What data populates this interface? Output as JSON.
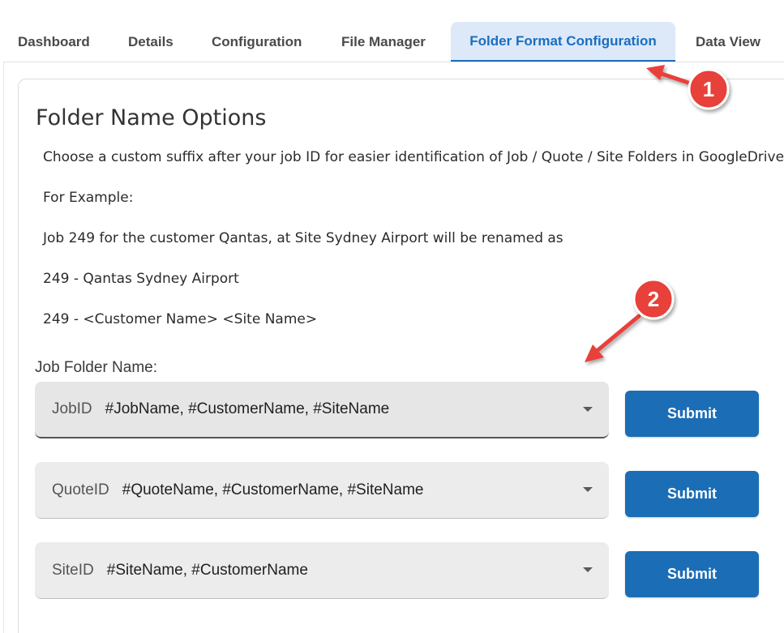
{
  "tabs": [
    {
      "label": "Dashboard"
    },
    {
      "label": "Details"
    },
    {
      "label": "Configuration"
    },
    {
      "label": "File Manager"
    },
    {
      "label": "Folder Format Configuration"
    },
    {
      "label": "Data View"
    }
  ],
  "active_tab": "Folder Format Configuration",
  "section": {
    "title": "Folder Name Options",
    "lines": [
      "Choose a custom suffix after your job ID for easier identification of Job / Quote / Site Folders in GoogleDrive. T",
      "For Example:",
      "Job 249 for the customer Qantas, at Site Sydney Airport will be renamed as",
      "249 - Qantas Sydney Airport",
      "249 - <Customer Name> <Site Name>"
    ],
    "field_label": "Job Folder Name:"
  },
  "selects": [
    {
      "prefix": "JobID",
      "value": "#JobName, #CustomerName, #SiteName"
    },
    {
      "prefix": "QuoteID",
      "value": "#QuoteName, #CustomerName, #SiteName"
    },
    {
      "prefix": "SiteID",
      "value": "#SiteName, #CustomerName"
    }
  ],
  "submit_label": "Submit",
  "annotations": [
    {
      "number": "1"
    },
    {
      "number": "2"
    }
  ],
  "colors": {
    "accent": "#1a6ebf",
    "button": "#1b6db6",
    "annotation": "#e8403a"
  }
}
